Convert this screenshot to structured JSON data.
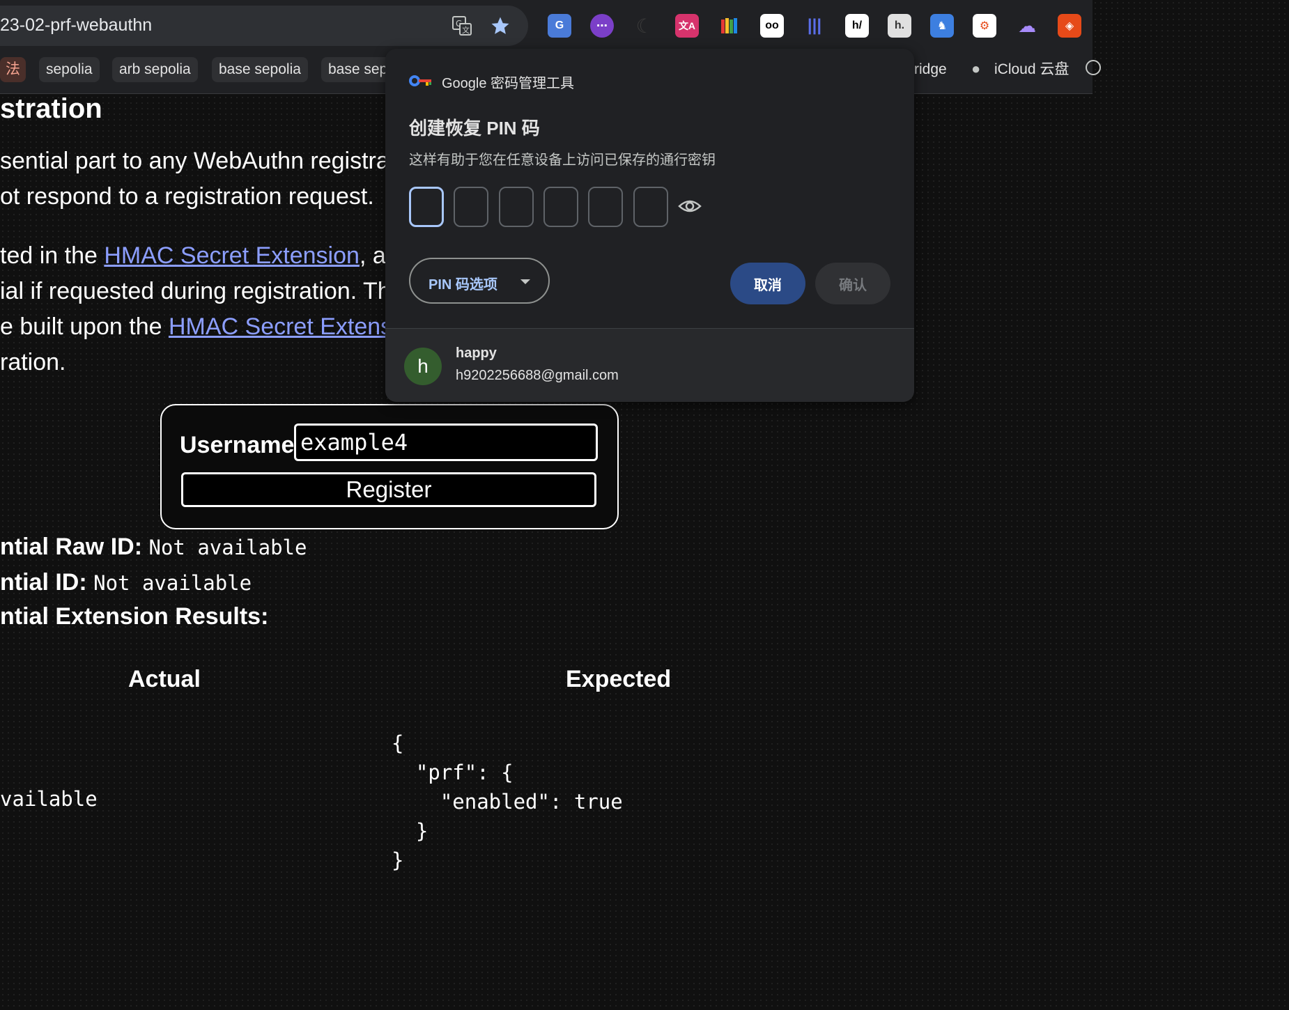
{
  "browser": {
    "url": "23-02-prf-webauthn",
    "bookmarks": [
      "法",
      "sepolia",
      "arb sepolia",
      "base sepolia",
      "base sep",
      "ridge",
      "iCloud 云盘"
    ]
  },
  "page": {
    "heading": "stration",
    "p1_line1": "sential part to any WebAuthn registrat",
    "p1_line2": "ot respond to a registration request.",
    "p2_line1_pre": "ted in the ",
    "p2_line1_link": "HMAC Secret Extension",
    "p2_line1_post": ", ar",
    "p2_line2": "ial if requested during registration. Th",
    "p2_line3_pre": "e built upon the ",
    "p2_line3_link": "HMAC Secret Extens",
    "p2_line4": "ration.",
    "username_label": "Username:",
    "username_value": "example4",
    "register_label": "Register",
    "raw_id_label": "ntial Raw ID:",
    "raw_id_value": "Not available",
    "id_label": "ntial ID:",
    "id_value": "Not available",
    "ext_results_label": "ntial Extension Results:",
    "col_actual": "Actual",
    "col_expected": "Expected",
    "actual_value": "vailable",
    "expected_code": "{\n  \"prf\": {\n    \"enabled\": true\n  }\n}"
  },
  "popup": {
    "title": "Google 密码管理工具",
    "heading": "创建恢复 PIN 码",
    "subtitle": "这样有助于您在任意设备上访问已保存的通行密钥",
    "pin_slots": 6,
    "pin_options_label": "PIN 码选项",
    "cancel_label": "取消",
    "confirm_label": "确认",
    "account_name": "happy",
    "account_email": "h9202256688@gmail.com",
    "avatar_letter": "h"
  },
  "colors": {
    "accent": "#a8c7fa",
    "link": "#8c9eff",
    "cancel_bg": "#2b4a86",
    "avatar_bg": "#345d2e"
  }
}
